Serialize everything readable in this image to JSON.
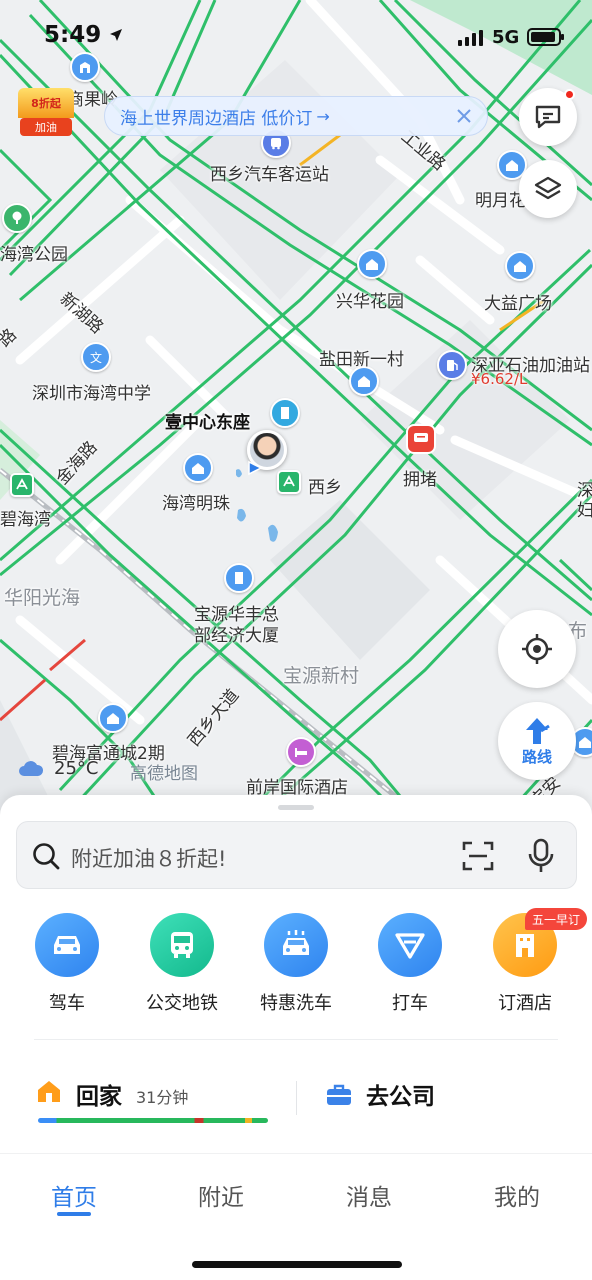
{
  "status_bar": {
    "time": "5:49",
    "network": "5G"
  },
  "promo_badge": {
    "tag": "8折起",
    "label": "加油"
  },
  "banner": {
    "text": "海上世界周边酒店 低价订",
    "arrow": "→"
  },
  "map": {
    "labels": [
      "招商果岭",
      "西乡汽车客运站",
      "明月花",
      "海湾公园",
      "新湖路",
      "兴华花园",
      "大益广场",
      "盐田新一村",
      "深亚石油加油站",
      "¥6.62/L",
      "深圳市海湾中学",
      "壹中心东座",
      "拥堵",
      "金海路",
      "西乡",
      "碧海湾",
      "海湾明珠",
      "华阳光海",
      "宝源华丰总",
      "部经济大厦",
      "宝源新村",
      "布",
      "西乡大道",
      "碧海富通城2期",
      "前岸国际酒店",
      "深",
      "妇",
      "工业路",
      "路",
      "宝安"
    ],
    "weather": "25°C",
    "logo": "高德地图"
  },
  "route_button": {
    "label": "路线"
  },
  "search": {
    "placeholder": "附近加油８折起!"
  },
  "shortcuts": [
    {
      "label": "驾车",
      "icon": "car-icon",
      "color": "#3a94f5"
    },
    {
      "label": "公交地铁",
      "icon": "bus-icon",
      "color": "#1fc79a"
    },
    {
      "label": "特惠洗车",
      "icon": "car-wash-icon",
      "color": "#3a94f5"
    },
    {
      "label": "打车",
      "icon": "taxi-icon",
      "color": "#3a94f5"
    },
    {
      "label": "订酒店",
      "icon": "hotel-icon",
      "color": "#ffa420"
    }
  ],
  "hotel_tag": "五一早订",
  "commute": {
    "home_label": "回家",
    "home_time": "31分钟",
    "work_label": "去公司"
  },
  "tabs": [
    {
      "label": "首页",
      "active": true
    },
    {
      "label": "附近",
      "active": false
    },
    {
      "label": "消息",
      "active": false
    },
    {
      "label": "我的",
      "active": false
    }
  ]
}
